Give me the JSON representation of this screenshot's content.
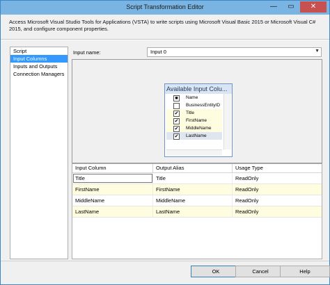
{
  "window": {
    "title": "Script Transformation Editor",
    "controls": {
      "minimize": "—",
      "maximize": "▭",
      "close": "✕"
    }
  },
  "description": "Access Microsoft Visual Studio Tools for Applications (VSTA) to write scripts using Microsoft Visual Basic 2015 or Microsoft Visual C# 2015, and configure component properties.",
  "nav": {
    "items": [
      {
        "label": "Script",
        "selected": false
      },
      {
        "label": "Input Columns",
        "selected": true
      },
      {
        "label": "Inputs and Outputs",
        "selected": false
      },
      {
        "label": "Connection Managers",
        "selected": false
      }
    ]
  },
  "input": {
    "label": "Input name:",
    "value": "Input 0"
  },
  "available_columns": {
    "title": "Available Input Colu...",
    "rows": [
      {
        "name": "Name",
        "checked": false,
        "partial": true
      },
      {
        "name": "BusinessEntityID",
        "checked": false
      },
      {
        "name": "Title",
        "checked": true
      },
      {
        "name": "FirstName",
        "checked": true
      },
      {
        "name": "MiddleName",
        "checked": true
      },
      {
        "name": "LastName",
        "checked": true
      }
    ]
  },
  "grid": {
    "headers": [
      "Input Column",
      "Output Alias",
      "Usage Type"
    ],
    "rows": [
      [
        "Title",
        "Title",
        "ReadOnly"
      ],
      [
        "FirstName",
        "FirstName",
        "ReadOnly"
      ],
      [
        "MiddleName",
        "MiddleName",
        "ReadOnly"
      ],
      [
        "LastName",
        "LastName",
        "ReadOnly"
      ]
    ]
  },
  "buttons": {
    "ok": "OK",
    "cancel": "Cancel",
    "help": "Help"
  },
  "check_glyphs": {
    "checked": "✔",
    "partial": "■",
    "unchecked": ""
  }
}
